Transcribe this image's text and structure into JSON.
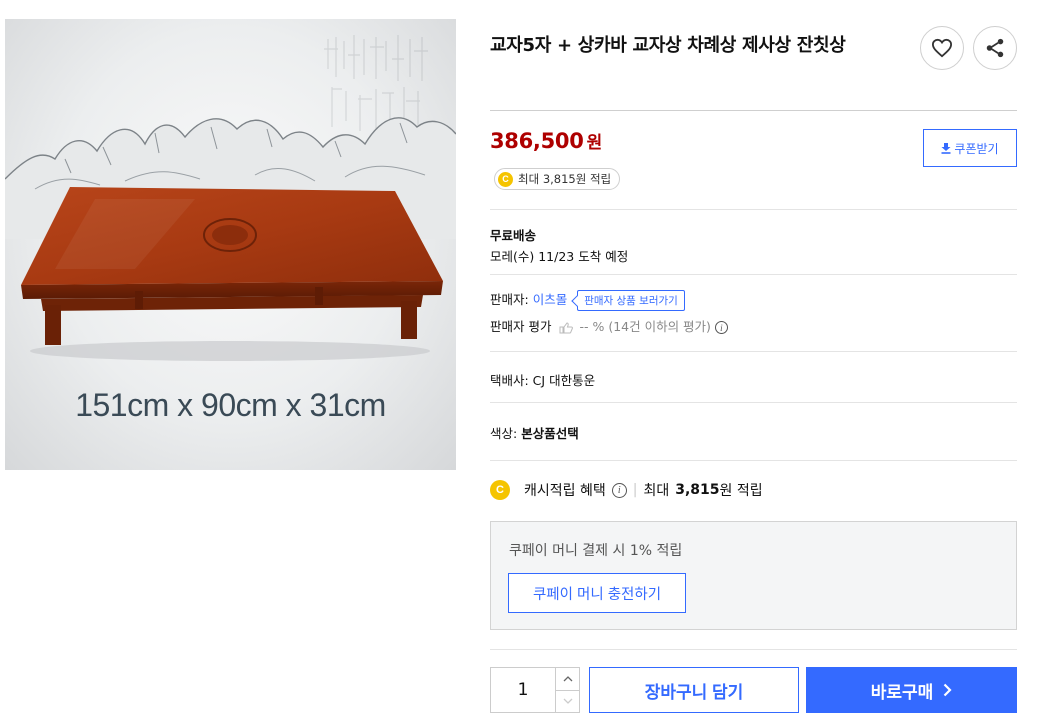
{
  "product": {
    "title": "교자5자 + 상카바 교자상 차례상 제사상 잔칫상",
    "image_caption": "151cm x 90cm x 31cm",
    "price_value": "386,500",
    "price_unit": "원"
  },
  "actions": {
    "like_icon": "heart-icon",
    "share_icon": "share-icon",
    "coupon_label": "쿠폰받기"
  },
  "cash": {
    "badge": "C",
    "pill_text": "최대 3,815원 적립"
  },
  "shipping": {
    "label": "무료배송",
    "arrival": "모레(수) 11/23 도착 예정"
  },
  "seller": {
    "label": "판매자:",
    "name": "이츠몰",
    "tooltip": "판매자 상품 보러가기",
    "rating_label": "판매자 평가",
    "rating_value": "-- %",
    "rating_note": "(14건 이하의 평가)"
  },
  "courier": {
    "text": "택배사: CJ 대한통운"
  },
  "option": {
    "label": "색상:",
    "value": "본상품선택"
  },
  "cash_benefit": {
    "label": "캐시적립 혜택",
    "max_prefix": "최대",
    "max_value": "3,815",
    "max_suffix": "원 적립"
  },
  "cupay": {
    "text": "쿠페이 머니 결제 시 1% 적립",
    "button": "쿠페이 머니 충전하기"
  },
  "purchase": {
    "quantity": "1",
    "cart_label": "장바구니 담기",
    "buy_label": "바로구매"
  },
  "colors": {
    "price": "#ae0000",
    "accent": "#346aff",
    "cash_badge": "#f5c400"
  }
}
